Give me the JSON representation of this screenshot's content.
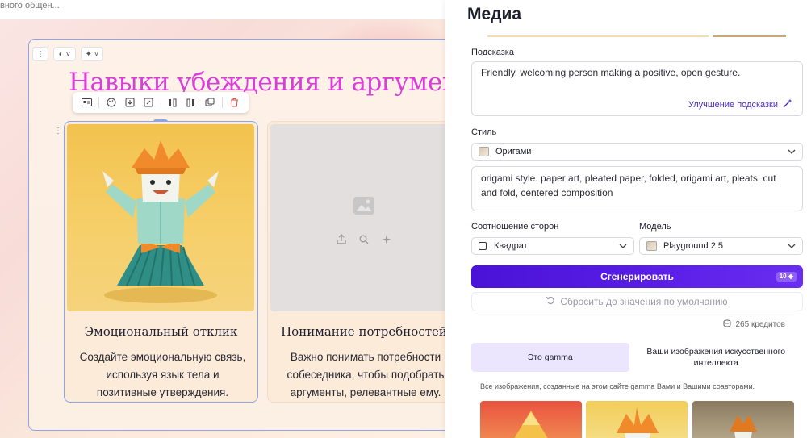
{
  "editor": {
    "crumb": "вного общен...",
    "title": "Навыки убеждения и аргумента",
    "card_tools": {
      "menu": "⋮",
      "theme": "◐ ˅",
      "ai": "✦ ˅"
    },
    "columns": [
      {
        "heading": "Эмоциональный отклик",
        "text": "Создайте эмоциональную связь, используя язык тела и позитивные утверждения."
      },
      {
        "heading": "Понимание потребностей",
        "text": "Важно понимать потребности собеседника, чтобы подобрать аргументы, релевантные ему."
      }
    ]
  },
  "panel": {
    "title": "Медиа",
    "prompt_label": "Подсказка",
    "prompt_value": "Friendly, welcoming person making a positive, open gesture.",
    "improve_label": "Улучшение подсказки",
    "style_label": "Стиль",
    "style_value": "Оригами",
    "style_description": "origami style. paper art, pleated paper, folded, origami art, pleats, cut and fold, centered composition",
    "aspect_label": "Соотношение сторон",
    "aspect_value": "Квадрат",
    "model_label": "Модель",
    "model_value": "Playground 2.5",
    "generate_label": "Сгенерировать",
    "generate_cost": "10",
    "reset_label": "Сбросить до значения по умолчанию",
    "credits": "265 кредитов",
    "tabs": [
      {
        "label": "Это gamma"
      },
      {
        "label": "Ваши изображения искусственного интеллекта"
      }
    ],
    "note": "Все изображения, созданные на этом сайте gamma Вами и Вашими соавторами."
  }
}
